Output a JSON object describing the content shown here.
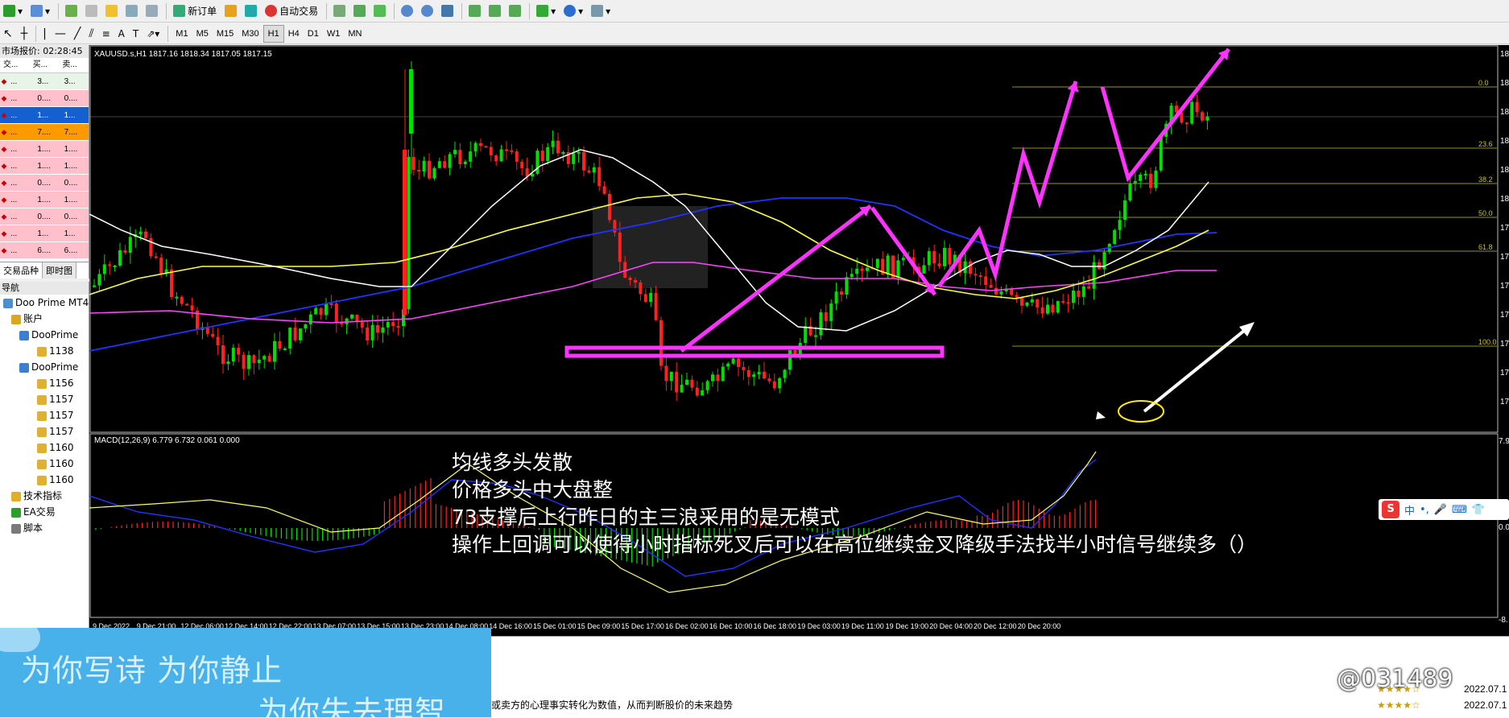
{
  "toolbar": {
    "new_order": "新订单",
    "auto_trading": "自动交易",
    "timeframes": [
      "M1",
      "M5",
      "M15",
      "M30",
      "H1",
      "H4",
      "D1",
      "W1",
      "MN"
    ]
  },
  "market_watch": {
    "title": "市场报价: 02:28:45",
    "columns": [
      "交...",
      "买...",
      "卖..."
    ],
    "rows": [
      {
        "c1": "...",
        "c2": "3...",
        "c3": "3...",
        "bg": "#e8f4e8"
      },
      {
        "c1": "...",
        "c2": "0....",
        "c3": "0....",
        "bg": "#ffc0cb"
      },
      {
        "c1": "...",
        "c2": "1...",
        "c3": "1...",
        "bg": "#1560d0"
      },
      {
        "c1": "...",
        "c2": "7....",
        "c3": "7....",
        "bg": "#ff9900"
      },
      {
        "c1": "...",
        "c2": "1....",
        "c3": "1....",
        "bg": "#ffc0cb"
      },
      {
        "c1": "...",
        "c2": "1....",
        "c3": "1....",
        "bg": "#ffc0cb"
      },
      {
        "c1": "...",
        "c2": "0....",
        "c3": "0....",
        "bg": "#ffc0cb"
      },
      {
        "c1": "...",
        "c2": "1....",
        "c3": "1....",
        "bg": "#ffc0cb"
      },
      {
        "c1": "...",
        "c2": "0....",
        "c3": "0....",
        "bg": "#ffc0cb"
      },
      {
        "c1": "...",
        "c2": "1...",
        "c3": "1...",
        "bg": "#ffc0cb"
      },
      {
        "c1": "...",
        "c2": "6....",
        "c3": "6....",
        "bg": "#ffc0cb"
      }
    ],
    "tabs": [
      "交易品种",
      "即时图"
    ]
  },
  "navigator": {
    "title": "导航",
    "items": [
      {
        "label": "Doo Prime MT4",
        "indent": 4
      },
      {
        "label": "账户",
        "indent": 14
      },
      {
        "label": "DooPrime",
        "indent": 24
      },
      {
        "label": "1138",
        "indent": 46
      },
      {
        "label": "DooPrime",
        "indent": 24
      },
      {
        "label": "1156",
        "indent": 46
      },
      {
        "label": "1157",
        "indent": 46
      },
      {
        "label": "1157",
        "indent": 46
      },
      {
        "label": "1157",
        "indent": 46
      },
      {
        "label": "1160",
        "indent": 46
      },
      {
        "label": "1160",
        "indent": 46
      },
      {
        "label": "1160",
        "indent": 46
      },
      {
        "label": "技术指标",
        "indent": 14
      },
      {
        "label": "EA交易",
        "indent": 14
      },
      {
        "label": "脚本",
        "indent": 14
      }
    ]
  },
  "chart": {
    "symbol_info": "XAUUSD.s,H1  1817.16  1818.34  1817.05  1817.15",
    "macd_info": "MACD(12,26,9) 6.779 6.732 0.061 0.000",
    "fib_levels": [
      "0.0",
      "23.6",
      "38.2",
      "50.0",
      "61.8",
      "100.0"
    ],
    "price_labels": [
      "18",
      "18",
      "18",
      "18",
      "18",
      "18",
      "17",
      "17",
      "17",
      "17",
      "17",
      "17",
      "17"
    ],
    "macd_labels": [
      "7.9",
      "0.0",
      "-8."
    ],
    "time_labels": [
      "9 Dec 2022",
      "9 Dec 21:00",
      "12 Dec 06:00",
      "12 Dec 14:00",
      "12 Dec 22:00",
      "13 Dec 07:00",
      "13 Dec 15:00",
      "13 Dec 23:00",
      "14 Dec 08:00",
      "14 Dec 16:00",
      "15 Dec 01:00",
      "15 Dec 09:00",
      "15 Dec 17:00",
      "16 Dec 02:00",
      "16 Dec 10:00",
      "16 Dec 18:00",
      "19 Dec 03:00",
      "19 Dec 11:00",
      "19 Dec 19:00",
      "20 Dec 04:00",
      "20 Dec 12:00",
      "20 Dec 20:00"
    ],
    "annotation": [
      "均线多头发散",
      "价格多头中大盘整",
      "73支撑后上行昨日的主三浪采用的是无模式",
      "操作上回调可以使得小时指标死叉后可以在高位继续金叉降级手法找半小时信号继续多（）"
    ],
    "colors": {
      "bull": "#00e000",
      "bear": "#ff2020",
      "magenta": "#ff33ff",
      "fib": "#c8c800"
    }
  },
  "ime": {
    "logo": "S",
    "lang": "中",
    "punct": "•,"
  },
  "banner": {
    "line1": "为你写诗 为你静止",
    "line2": "为你失去理智"
  },
  "bottom": {
    "indicator_desc": "或卖方的心理事实转化为数值，从而判断股价的未来趋势",
    "dates": [
      "2022.07.1",
      "2022.07.1"
    ],
    "watermark": "@031489"
  }
}
